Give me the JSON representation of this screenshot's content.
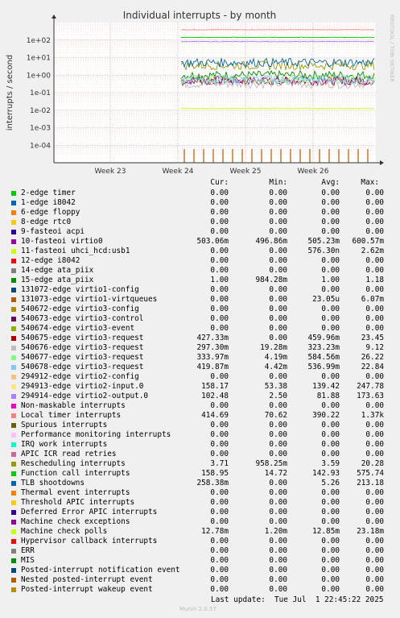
{
  "title": "Individual interrupts - by month",
  "side_label": "RRDTOOL / TOBI OETIKER",
  "munin_version": "Munin 2.0.57",
  "last_update": "Last update:  Tue Jul  1 22:45:22 2025",
  "colors": {
    "background": "#f0f0f0",
    "plot_bg": "#ffffff",
    "grid_major": "#e0a0a0",
    "grid_minor": "#f0d0d0",
    "axis": "#000000"
  },
  "legend_headers": {
    "cur": "Cur:",
    "min": "Min:",
    "avg": "Avg:",
    "max": "Max:"
  },
  "chart_data": {
    "type": "line",
    "title": "Individual interrupts - by month",
    "ylabel": "interrupts / second",
    "y_scale": "log",
    "ylim": [
      1e-05,
      1000
    ],
    "yticks": [
      {
        "value": 100,
        "label": "1e+02"
      },
      {
        "value": 10,
        "label": "1e+01"
      },
      {
        "value": 1,
        "label": "1e+00"
      },
      {
        "value": 0.1,
        "label": "1e-01"
      },
      {
        "value": 0.01,
        "label": "1e-02"
      },
      {
        "value": 0.001,
        "label": "1e-03"
      },
      {
        "value": 0.0001,
        "label": "1e-04"
      }
    ],
    "xticks": [
      "Week 23",
      "Week 24",
      "Week 25",
      "Week 26"
    ],
    "grid": true,
    "series": [
      {
        "name": "2-edge timer",
        "color": "#00cc00",
        "cur": "0.00",
        "min": "0.00",
        "avg": "0.00",
        "max": "0.00",
        "level": null
      },
      {
        "name": "1-edge i8042",
        "color": "#0066b3",
        "cur": "0.00",
        "min": "0.00",
        "avg": "0.00",
        "max": "0.00",
        "level": null
      },
      {
        "name": "6-edge floppy",
        "color": "#ff8000",
        "cur": "0.00",
        "min": "0.00",
        "avg": "0.00",
        "max": "0.00",
        "level": null
      },
      {
        "name": "8-edge rtc0",
        "color": "#ffcc00",
        "cur": "0.00",
        "min": "0.00",
        "avg": "0.00",
        "max": "0.00",
        "level": null
      },
      {
        "name": "9-fasteoi acpi",
        "color": "#330099",
        "cur": "0.00",
        "min": "0.00",
        "avg": "0.00",
        "max": "0.00",
        "level": null
      },
      {
        "name": "10-fasteoi virtio0",
        "color": "#990099",
        "cur": "503.06m",
        "min": "496.86m",
        "avg": "505.23m",
        "max": "600.57m",
        "level": 0.5
      },
      {
        "name": "11-fasteoi uhci_hcd:usb1",
        "color": "#ccff00",
        "cur": "0.00",
        "min": "0.00",
        "avg": "576.30n",
        "max": "2.62m",
        "level": null
      },
      {
        "name": "12-edge i8042",
        "color": "#ff0000",
        "cur": "0.00",
        "min": "0.00",
        "avg": "0.00",
        "max": "0.00",
        "level": null
      },
      {
        "name": "14-edge ata_piix",
        "color": "#808080",
        "cur": "0.00",
        "min": "0.00",
        "avg": "0.00",
        "max": "0.00",
        "level": null
      },
      {
        "name": "15-edge ata_piix",
        "color": "#008f00",
        "cur": "1.00",
        "min": "984.28m",
        "avg": "1.00",
        "max": "1.18",
        "level": 1.0
      },
      {
        "name": "131072-edge virtio1-config",
        "color": "#00487d",
        "cur": "0.00",
        "min": "0.00",
        "avg": "0.00",
        "max": "0.00",
        "level": null
      },
      {
        "name": "131073-edge virtio1-virtqueues",
        "color": "#b35a00",
        "cur": "0.00",
        "min": "0.00",
        "avg": "23.05u",
        "max": "6.07m",
        "level": null
      },
      {
        "name": "540672-edge virtio3-config",
        "color": "#b38f00",
        "cur": "0.00",
        "min": "0.00",
        "avg": "0.00",
        "max": "0.00",
        "level": null
      },
      {
        "name": "540673-edge virtio3-control",
        "color": "#6b006b",
        "cur": "0.00",
        "min": "0.00",
        "avg": "0.00",
        "max": "0.00",
        "level": null
      },
      {
        "name": "540674-edge virtio3-event",
        "color": "#8fb300",
        "cur": "0.00",
        "min": "0.00",
        "avg": "0.00",
        "max": "0.00",
        "level": null
      },
      {
        "name": "540675-edge virtio3-request",
        "color": "#b30000",
        "cur": "427.33m",
        "min": "0.00",
        "avg": "459.96m",
        "max": "23.45",
        "level": 0.46
      },
      {
        "name": "540676-edge virtio3-request",
        "color": "#bebebe",
        "cur": "297.30m",
        "min": "19.28m",
        "avg": "323.23m",
        "max": "9.12",
        "level": 0.32
      },
      {
        "name": "540677-edge virtio3-request",
        "color": "#80ff80",
        "cur": "333.97m",
        "min": "4.19m",
        "avg": "584.56m",
        "max": "26.22",
        "level": 0.58
      },
      {
        "name": "540678-edge virtio3-request",
        "color": "#80c9ff",
        "cur": "419.87m",
        "min": "4.42m",
        "avg": "536.99m",
        "max": "22.84",
        "level": 0.54
      },
      {
        "name": "294912-edge virtio2-config",
        "color": "#ffc080",
        "cur": "0.00",
        "min": "0.00",
        "avg": "0.00",
        "max": "0.00",
        "level": null
      },
      {
        "name": "294913-edge virtio2-input.0",
        "color": "#ffe680",
        "cur": "158.17",
        "min": "53.38",
        "avg": "139.42",
        "max": "247.78",
        "level": 139.42
      },
      {
        "name": "294914-edge virtio2-output.0",
        "color": "#aa80ff",
        "cur": "102.48",
        "min": "2.50",
        "avg": "81.88",
        "max": "173.63",
        "level": 81.88
      },
      {
        "name": "Non-maskable interrupts",
        "color": "#ee00cc",
        "cur": "0.00",
        "min": "0.00",
        "avg": "0.00",
        "max": "0.00",
        "level": null
      },
      {
        "name": "Local timer interrupts",
        "color": "#ff8080",
        "cur": "414.69",
        "min": "70.62",
        "avg": "390.22",
        "max": "1.37k",
        "level": 390.22
      },
      {
        "name": "Spurious interrupts",
        "color": "#666600",
        "cur": "0.00",
        "min": "0.00",
        "avg": "0.00",
        "max": "0.00",
        "level": null
      },
      {
        "name": "Performance monitoring interrupts",
        "color": "#ffbfff",
        "cur": "0.00",
        "min": "0.00",
        "avg": "0.00",
        "max": "0.00",
        "level": null
      },
      {
        "name": "IRQ work interrupts",
        "color": "#00ffcc",
        "cur": "0.00",
        "min": "0.00",
        "avg": "0.00",
        "max": "0.00",
        "level": null
      },
      {
        "name": "APIC ICR read retries",
        "color": "#cc6699",
        "cur": "0.00",
        "min": "0.00",
        "avg": "0.00",
        "max": "0.00",
        "level": null
      },
      {
        "name": "Rescheduling interrupts",
        "color": "#999900",
        "cur": "3.71",
        "min": "958.25m",
        "avg": "3.59",
        "max": "20.28",
        "level": 3.59
      },
      {
        "name": "Function call interrupts",
        "color": "#00cc00",
        "cur": "158.95",
        "min": "14.72",
        "avg": "142.93",
        "max": "575.74",
        "level": 142.93
      },
      {
        "name": "TLB shootdowns",
        "color": "#0066b3",
        "cur": "258.38m",
        "min": "0.00",
        "avg": "5.26",
        "max": "213.18",
        "level": 5.26
      },
      {
        "name": "Thermal event interrupts",
        "color": "#ff8000",
        "cur": "0.00",
        "min": "0.00",
        "avg": "0.00",
        "max": "0.00",
        "level": null
      },
      {
        "name": "Threshold APIC interrupts",
        "color": "#ffcc00",
        "cur": "0.00",
        "min": "0.00",
        "avg": "0.00",
        "max": "0.00",
        "level": null
      },
      {
        "name": "Deferred Error APIC interrupts",
        "color": "#330099",
        "cur": "0.00",
        "min": "0.00",
        "avg": "0.00",
        "max": "0.00",
        "level": null
      },
      {
        "name": "Machine check exceptions",
        "color": "#990099",
        "cur": "0.00",
        "min": "0.00",
        "avg": "0.00",
        "max": "0.00",
        "level": null
      },
      {
        "name": "Machine check polls",
        "color": "#ccff00",
        "cur": "12.78m",
        "min": "1.20m",
        "avg": "12.85m",
        "max": "23.18m",
        "level": 0.01285
      },
      {
        "name": "Hypervisor callback interrupts",
        "color": "#ff0000",
        "cur": "0.00",
        "min": "0.00",
        "avg": "0.00",
        "max": "0.00",
        "level": null
      },
      {
        "name": "ERR",
        "color": "#808080",
        "cur": "0.00",
        "min": "0.00",
        "avg": "0.00",
        "max": "0.00",
        "level": null
      },
      {
        "name": "MIS",
        "color": "#008f00",
        "cur": "0.00",
        "min": "0.00",
        "avg": "0.00",
        "max": "0.00",
        "level": null
      },
      {
        "name": "Posted-interrupt notification event",
        "color": "#00487d",
        "cur": "0.00",
        "min": "0.00",
        "avg": "0.00",
        "max": "0.00",
        "level": null
      },
      {
        "name": "Nested posted-interrupt event",
        "color": "#b35a00",
        "cur": "0.00",
        "min": "0.00",
        "avg": "0.00",
        "max": "0.00",
        "level": null
      },
      {
        "name": "Posted-interrupt wakeup event",
        "color": "#b38f00",
        "cur": "0.00",
        "min": "0.00",
        "avg": "0.00",
        "max": "0.00",
        "level": null
      }
    ]
  }
}
